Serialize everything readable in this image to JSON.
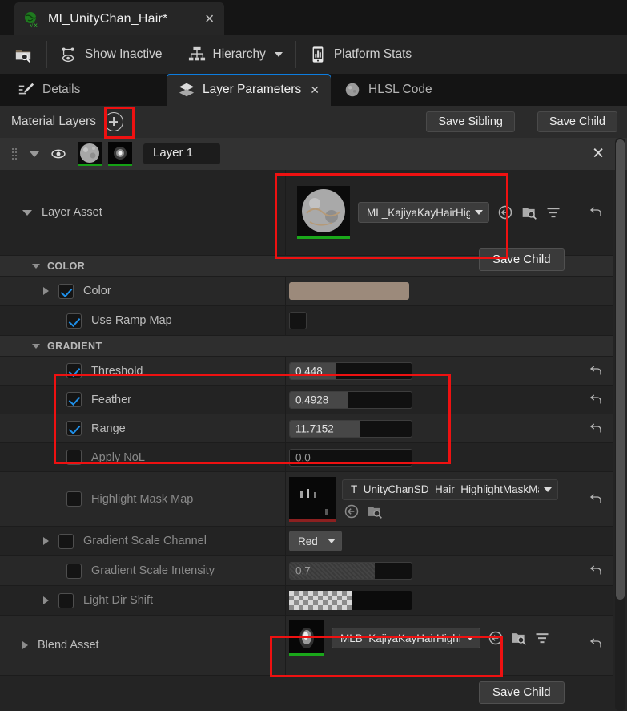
{
  "window": {
    "tab_title": "MI_UnityChan_Hair*",
    "tab_icon": "material-instance-icon",
    "close_icon": "close-icon"
  },
  "toolbar": {
    "items": [
      {
        "label": "",
        "icon": "folder-search-icon",
        "name": "browse-asset-button"
      },
      {
        "label": "Show Inactive",
        "icon": "show-inactive-icon",
        "name": "show-inactive-button"
      },
      {
        "label": "Hierarchy",
        "icon": "hierarchy-icon",
        "name": "hierarchy-button",
        "caret": true
      },
      {
        "label": "Platform Stats",
        "icon": "platform-stats-icon",
        "name": "platform-stats-button"
      }
    ]
  },
  "tabs": [
    {
      "label": "Details",
      "icon": "details-icon",
      "active": false,
      "closable": false
    },
    {
      "label": "Layer Parameters",
      "icon": "layers-icon",
      "active": true,
      "closable": true,
      "close_icon": "close-icon"
    },
    {
      "label": "HLSL Code",
      "icon": "sphere-icon",
      "active": false,
      "closable": false
    }
  ],
  "panel": {
    "title": "Material Layers",
    "add_icon": "plus-circle-icon",
    "save_sibling_label": "Save Sibling",
    "save_child_label": "Save Child"
  },
  "layer": {
    "name": "Layer 1",
    "grip_icon": "drag-handle-icon",
    "expand_icon": "triangle-down-icon",
    "visibility_icon": "eye-icon",
    "layer_thumb_icon": "material-sphere-thumbnail",
    "blend_thumb_icon": "blend-mask-thumbnail",
    "remove_icon": "close-icon"
  },
  "overlay_buttons": {
    "save_child_top": "Save Child",
    "save_child_bottom": "Save Child"
  },
  "properties": {
    "layer_asset": {
      "label": "Layer Asset",
      "expand_icon": "triangle-down-icon",
      "asset_name": "ML_KajiyaKayHairHig",
      "thumb_icon": "material-layer-thumbnail",
      "icons": [
        "browse-to-asset-icon",
        "open-in-browser-icon",
        "filter-icon"
      ],
      "reset_icon": "reset-arrow-icon"
    },
    "categories": [
      {
        "name": "COLOR"
      },
      {
        "name": "GRADIENT"
      }
    ],
    "color_rows": [
      {
        "label": "Color",
        "checked": true,
        "enabled": true,
        "has_expand": true,
        "control": "color-swatch",
        "swatch_color": "#9c8a7b",
        "reset": false
      },
      {
        "label": "Use Ramp Map",
        "checked": true,
        "enabled": true,
        "has_expand": false,
        "control": "small-swatch",
        "swatch_color": "#131313",
        "reset": false
      }
    ],
    "gradient_rows": [
      {
        "label": "Threshold",
        "checked": true,
        "enabled": true,
        "control": "number-slider",
        "value": "0.448",
        "fill_pct": 38,
        "reset": true
      },
      {
        "label": "Feather",
        "checked": true,
        "enabled": true,
        "control": "number-slider",
        "value": "0.4928",
        "fill_pct": 48,
        "reset": true
      },
      {
        "label": "Range",
        "checked": true,
        "enabled": true,
        "control": "number-slider",
        "value": "11.7152",
        "fill_pct": 58,
        "reset": true
      },
      {
        "label": "Apply NoL",
        "checked": false,
        "enabled": false,
        "control": "number",
        "value": "0.0",
        "fill_pct": 0,
        "reset": false
      }
    ],
    "texture_row": {
      "label": "Highlight Mask Map",
      "checked": false,
      "enabled": false,
      "asset_name": "T_UnityChanSD_Hair_HighlightMaskMap",
      "thumb_icon": "texture-thumbnail",
      "icons": [
        "browse-to-asset-icon",
        "open-in-browser-icon"
      ],
      "reset_icon": "reset-arrow-icon"
    },
    "enum_row": {
      "label": "Gradient Scale Channel",
      "checked": false,
      "enabled": false,
      "has_expand": true,
      "value": "Red",
      "reset": false
    },
    "intensity_row": {
      "label": "Gradient Scale Intensity",
      "checked": false,
      "enabled": false,
      "control": "number-slider",
      "value": "0.7",
      "fill_pct": 70,
      "reset": true
    },
    "lightdir_row": {
      "label": "Light Dir Shift",
      "checked": false,
      "enabled": false,
      "has_expand": true,
      "control": "checker-swatch",
      "reset": false
    },
    "blend_asset": {
      "label": "Blend Asset",
      "expand_icon": "triangle-right-icon",
      "asset_name": "MLB_KajiyaKayHairHighlightI",
      "thumb_icon": "blend-layer-thumbnail",
      "icons": [
        "browse-to-asset-icon",
        "open-in-browser-icon",
        "filter-icon"
      ],
      "reset_icon": "reset-arrow-icon"
    }
  },
  "scrollbar": {
    "name": "vertical-scrollbar"
  },
  "highlights": {
    "accent_color": "#ee1111",
    "boxes": [
      {
        "name": "add-layer-highlight"
      },
      {
        "name": "layer-asset-highlight"
      },
      {
        "name": "gradient-params-highlight"
      },
      {
        "name": "blend-asset-highlight"
      }
    ]
  }
}
